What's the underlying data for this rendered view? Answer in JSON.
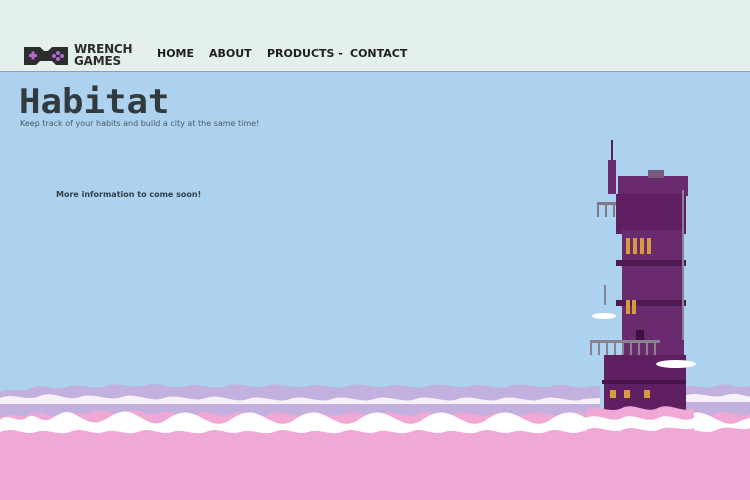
{
  "header": {
    "logo": {
      "line1": "WRENCH",
      "line2": "GAMES",
      "icon": "game-controller-icon"
    },
    "nav": [
      {
        "label": "HOME"
      },
      {
        "label": "ABOUT"
      },
      {
        "label": "PRODUCTS -"
      },
      {
        "label": "CONTACT"
      }
    ]
  },
  "main": {
    "title": "Habitat",
    "subtitle": "Keep track of your habits and build a city at the same time!",
    "info": "More information to come soon!"
  },
  "colors": {
    "sky": "#acd2ef",
    "header_bg": "#e3f0ee",
    "cloud_pink": "#f0a8d6",
    "cloud_lavender": "#c2b0de",
    "tower_purple": "#6a2a6e",
    "logo_purple": "#8a3aa8"
  }
}
